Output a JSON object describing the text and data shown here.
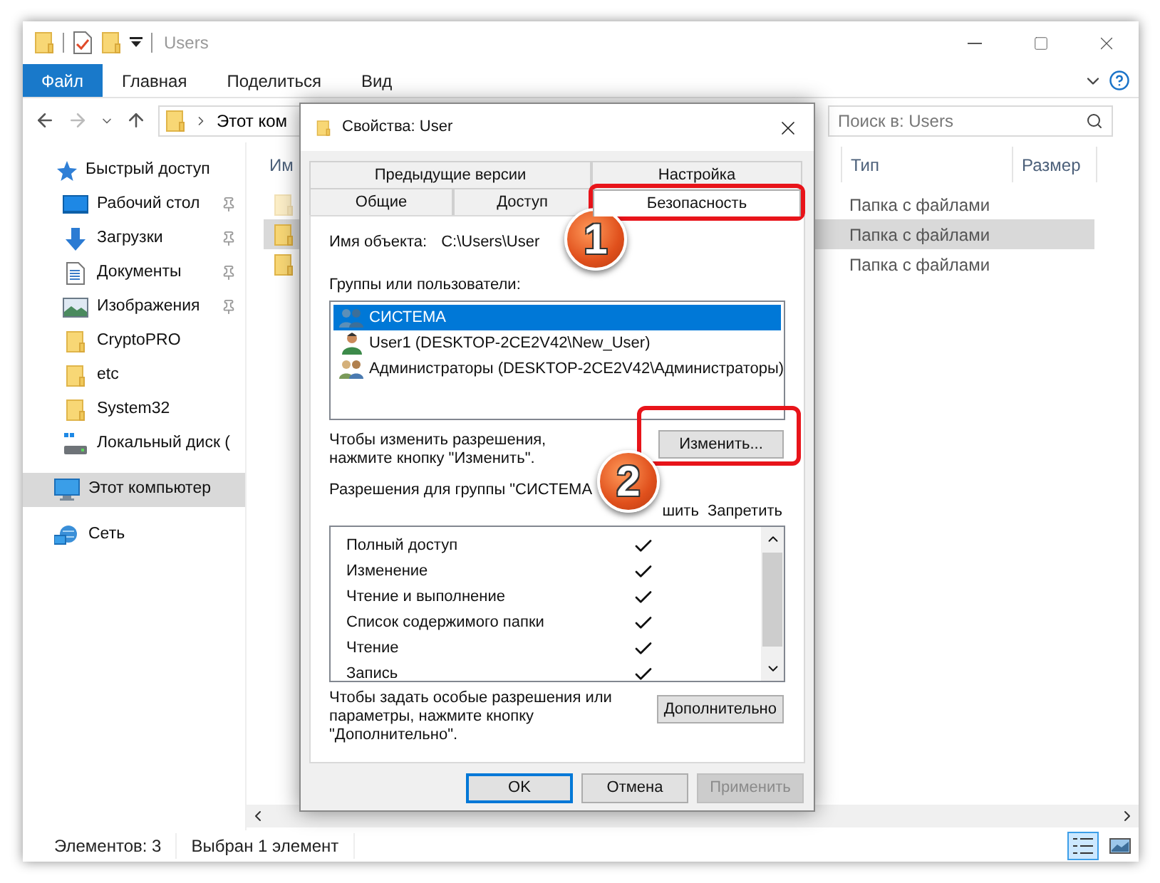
{
  "explorer": {
    "title": "Users",
    "ribbon_tabs": [
      {
        "label": "Файл",
        "selected": true
      },
      {
        "label": "Главная",
        "selected": false
      },
      {
        "label": "Поделиться",
        "selected": false
      },
      {
        "label": "Вид",
        "selected": false
      }
    ],
    "address": {
      "crumb": "Этот ком"
    },
    "search": {
      "placeholder": "Поиск в: Users"
    },
    "nav": [
      {
        "label": "Быстрый доступ",
        "kind": "quick",
        "selected": false,
        "children": [
          {
            "label": "Рабочий стол",
            "kind": "desktop",
            "pinned": true,
            "selected": false
          },
          {
            "label": "Загрузки",
            "kind": "downloads",
            "pinned": true,
            "selected": false
          },
          {
            "label": "Документы",
            "kind": "documents",
            "pinned": true,
            "selected": false
          },
          {
            "label": "Изображения",
            "kind": "pictures",
            "pinned": true,
            "selected": false
          },
          {
            "label": "CryptoPRO",
            "kind": "folder",
            "pinned": false,
            "selected": false
          },
          {
            "label": "etc",
            "kind": "folder",
            "pinned": false,
            "selected": false
          },
          {
            "label": "System32",
            "kind": "folder",
            "pinned": false,
            "selected": false
          },
          {
            "label": "Локальный диск (",
            "kind": "drive",
            "pinned": false,
            "selected": false
          }
        ]
      },
      {
        "label": "Этот компьютер",
        "kind": "pc",
        "selected": true
      },
      {
        "label": "Сеть",
        "kind": "network",
        "selected": false
      }
    ],
    "columns": [
      "Им",
      "Тип",
      "Размер"
    ],
    "rows": [
      {
        "type": "Папка с файлами",
        "selected": false,
        "hidden": true
      },
      {
        "type": "Папка с файлами",
        "selected": true,
        "hidden": false
      },
      {
        "type": "Папка с файлами",
        "selected": false,
        "hidden": false
      }
    ],
    "status": [
      "Элементов: 3",
      "Выбран 1 элемент"
    ]
  },
  "dialog": {
    "title": "Свойства: User",
    "tab_rows": [
      [
        {
          "label": "Предыдущие версии",
          "selected": false
        },
        {
          "label": "Настройка",
          "selected": false
        }
      ],
      [
        {
          "label": "Общие",
          "selected": false
        },
        {
          "label": "Доступ",
          "selected": false
        },
        {
          "label": "Безопасность",
          "selected": true
        }
      ]
    ],
    "object_label": "Имя объекта:",
    "object_value": "C:\\Users\\User",
    "groups_label": "Группы или пользователи:",
    "groups": [
      {
        "label": "СИСТЕМА",
        "kind": "group",
        "selected": true
      },
      {
        "label": "User1 (DESKTOP-2CE2V42\\New_User)",
        "kind": "user",
        "selected": false
      },
      {
        "label": "Администраторы (DESKTOP-2CE2V42\\Администраторы)",
        "kind": "admins",
        "selected": false
      }
    ],
    "change_hint": "Чтобы изменить разрешения, нажмите кнопку \"Изменить\".",
    "change_button": "Изменить...",
    "permissions_label": "Разрешения для группы \"СИСТЕМА",
    "permission_columns": [
      "шить",
      "Запретить"
    ],
    "permissions": [
      {
        "label": "Полный доступ",
        "allow": true,
        "deny": false
      },
      {
        "label": "Изменение",
        "allow": true,
        "deny": false
      },
      {
        "label": "Чтение и выполнение",
        "allow": true,
        "deny": false
      },
      {
        "label": "Список содержимого папки",
        "allow": true,
        "deny": false
      },
      {
        "label": "Чтение",
        "allow": true,
        "deny": false
      },
      {
        "label": "Запись",
        "allow": true,
        "deny": false
      }
    ],
    "advanced_hint": "Чтобы задать особые разрешения или параметры, нажмите кнопку \"Дополнительно\".",
    "advanced_button": "Дополнительно",
    "buttons": [
      {
        "label": "OK",
        "default": true,
        "disabled": false
      },
      {
        "label": "Отмена",
        "default": false,
        "disabled": false
      },
      {
        "label": "Применить",
        "default": false,
        "disabled": true
      }
    ]
  },
  "callouts": [
    "1",
    "2"
  ]
}
